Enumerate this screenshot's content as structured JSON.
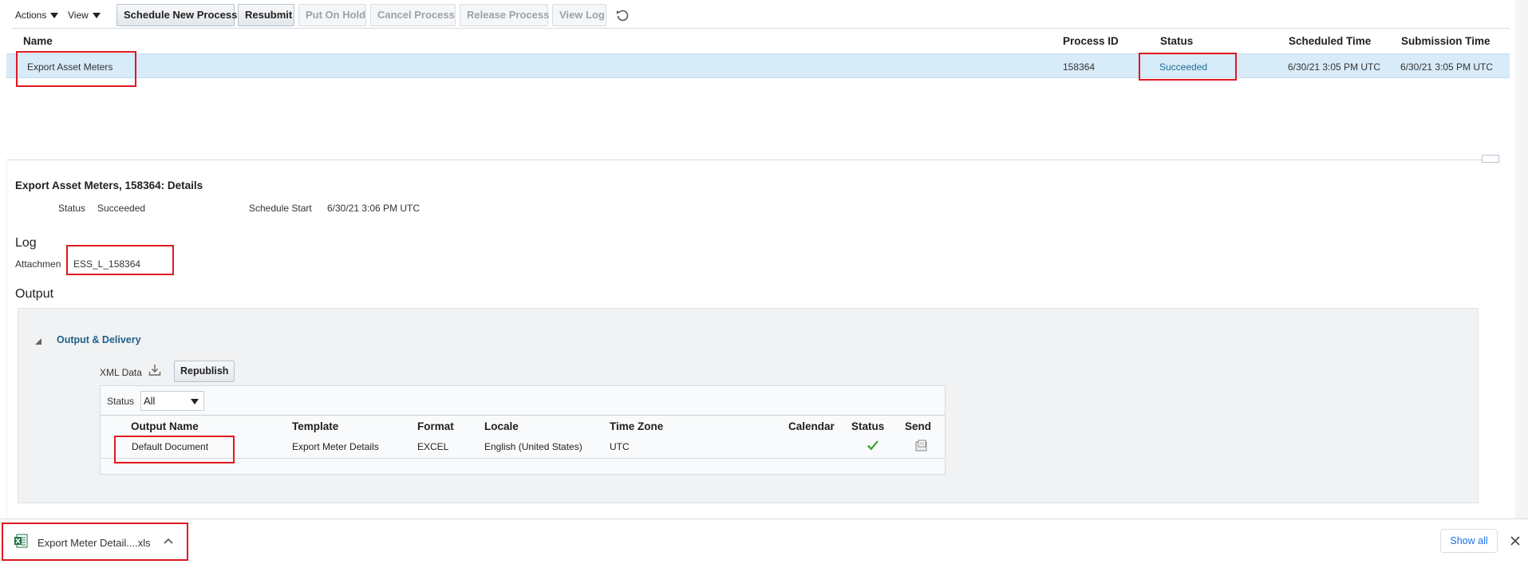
{
  "toolbar": {
    "actions_label": "Actions",
    "view_label": "View",
    "buttons": {
      "schedule": "Schedule New Process",
      "resubmit": "Resubmit",
      "hold": "Put On Hold",
      "cancel": "Cancel Process",
      "release": "Release Process",
      "view_log": "View Log"
    }
  },
  "process_table": {
    "columns": {
      "name": "Name",
      "process_id": "Process ID",
      "status": "Status",
      "scheduled_time": "Scheduled Time",
      "submission_time": "Submission Time"
    },
    "row": {
      "name": "Export Asset Meters",
      "process_id": "158364",
      "status": "Succeeded",
      "scheduled_time": "6/30/21 3:05 PM UTC",
      "submission_time": "6/30/21 3:05 PM UTC"
    }
  },
  "details": {
    "title": "Export Asset Meters, 158364: Details",
    "status_label": "Status",
    "status_value": "Succeeded",
    "schedule_start_label": "Schedule Start",
    "schedule_start_value": "6/30/21 3:06 PM UTC",
    "log_heading": "Log",
    "attachment_label": "Attachmen",
    "attachment_link": "ESS_L_158364",
    "output_heading": "Output"
  },
  "output_delivery": {
    "title": "Output & Delivery",
    "xml_data_label": "XML Data",
    "republish_label": "Republish",
    "status_filter_label": "Status",
    "status_filter_value": "All",
    "columns": {
      "output_name": "Output Name",
      "template": "Template",
      "format": "Format",
      "locale": "Locale",
      "time_zone": "Time Zone",
      "calendar": "Calendar",
      "status": "Status",
      "send": "Send"
    },
    "row": {
      "output_name": "Default Document",
      "template": "Export Meter Details",
      "format": "EXCEL",
      "locale": "English (United States)",
      "time_zone": "UTC",
      "calendar": ""
    }
  },
  "download_bar": {
    "file_name": "Export Meter Detail....xls",
    "show_all": "Show all"
  },
  "colors": {
    "selected_row": "#d8ebf9",
    "link": "#1f6a91",
    "highlight": "#e0181f",
    "success": "#3aa537"
  }
}
